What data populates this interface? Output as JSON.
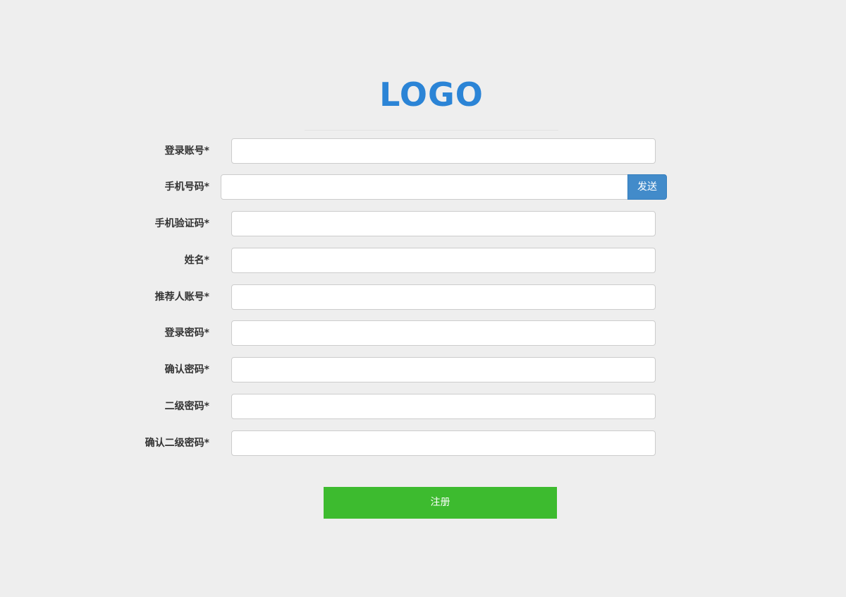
{
  "header": {
    "logo_text": "LOGO"
  },
  "form": {
    "fields": [
      {
        "label": "登录账号*",
        "value": "",
        "placeholder": ""
      },
      {
        "label": "手机号码*",
        "value": "",
        "placeholder": ""
      },
      {
        "label": "手机验证码*",
        "value": "",
        "placeholder": ""
      },
      {
        "label": "姓名*",
        "value": "",
        "placeholder": ""
      },
      {
        "label": "推荐人账号*",
        "value": "",
        "placeholder": ""
      },
      {
        "label": "登录密码*",
        "value": "",
        "placeholder": ""
      },
      {
        "label": "确认密码*",
        "value": "",
        "placeholder": ""
      },
      {
        "label": "二级密码*",
        "value": "",
        "placeholder": ""
      },
      {
        "label": "确认二级密码*",
        "value": "",
        "placeholder": ""
      }
    ],
    "send_button_label": "发送",
    "submit_button_label": "注册"
  },
  "colors": {
    "background": "#eeeeee",
    "logo": "#2b84d6",
    "send_button": "#428bca",
    "submit_button": "#3dbb2f"
  }
}
